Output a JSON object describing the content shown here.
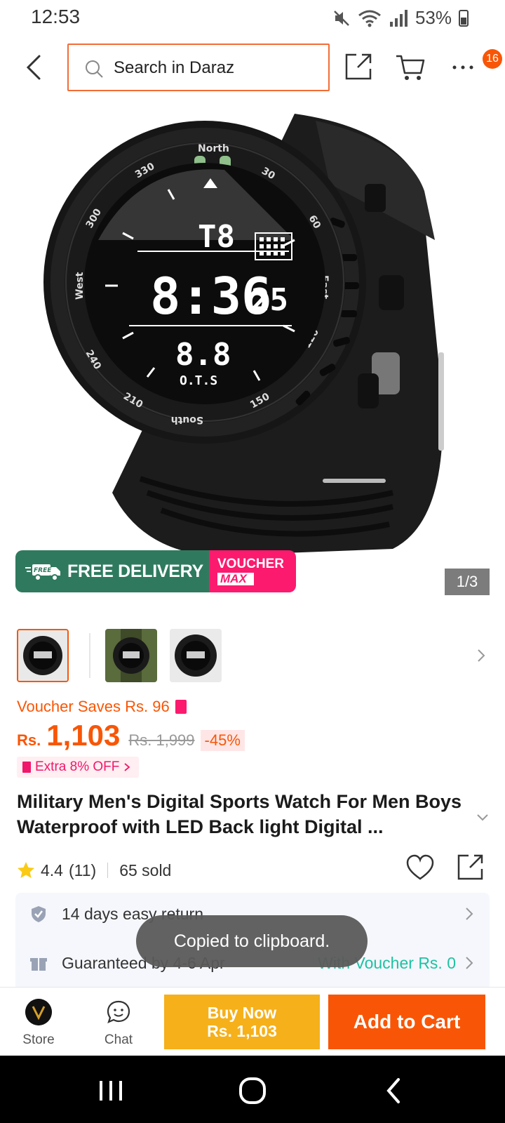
{
  "status_bar": {
    "time": "12:53",
    "battery": "53%"
  },
  "search": {
    "placeholder": "Search in Daraz"
  },
  "top_bar": {
    "notification_count": "16"
  },
  "gallery": {
    "page_indicator": "1/3",
    "promo_free_delivery": "FREE DELIVERY",
    "promo_free_badge": "FREE",
    "promo_voucher": "VOUCHER",
    "promo_max": "MAX"
  },
  "product": {
    "voucher_saves": "Voucher Saves Rs. 96",
    "currency": "Rs.",
    "price": "1,103",
    "original_price": "Rs. 1,999",
    "discount": "-45%",
    "extra_off": "Extra 8% OFF",
    "title": "Military Men's Digital Sports Watch For Men Boys Waterproof with LED Back light Digital ...",
    "rating": "4.4",
    "rating_count": "(11)",
    "sold": "65 sold"
  },
  "services": [
    {
      "text": "14 days easy return",
      "extra": ""
    },
    {
      "text": "Guaranteed by 4-6 Apr",
      "extra": "With Voucher Rs. 0"
    }
  ],
  "toast": "Copied to clipboard.",
  "bottom_bar": {
    "store_label": "Store",
    "chat_label": "Chat",
    "buy_now_line1": "Buy Now",
    "buy_now_line2": "Rs. 1,103",
    "add_to_cart": "Add to Cart"
  },
  "colors": {
    "brand_orange": "#f85606",
    "buy_now_yellow": "#f6b01a",
    "teal": "#1dc2a2",
    "free_delivery_green": "#2f7a5f",
    "voucher_pink": "#fb1a6e"
  }
}
